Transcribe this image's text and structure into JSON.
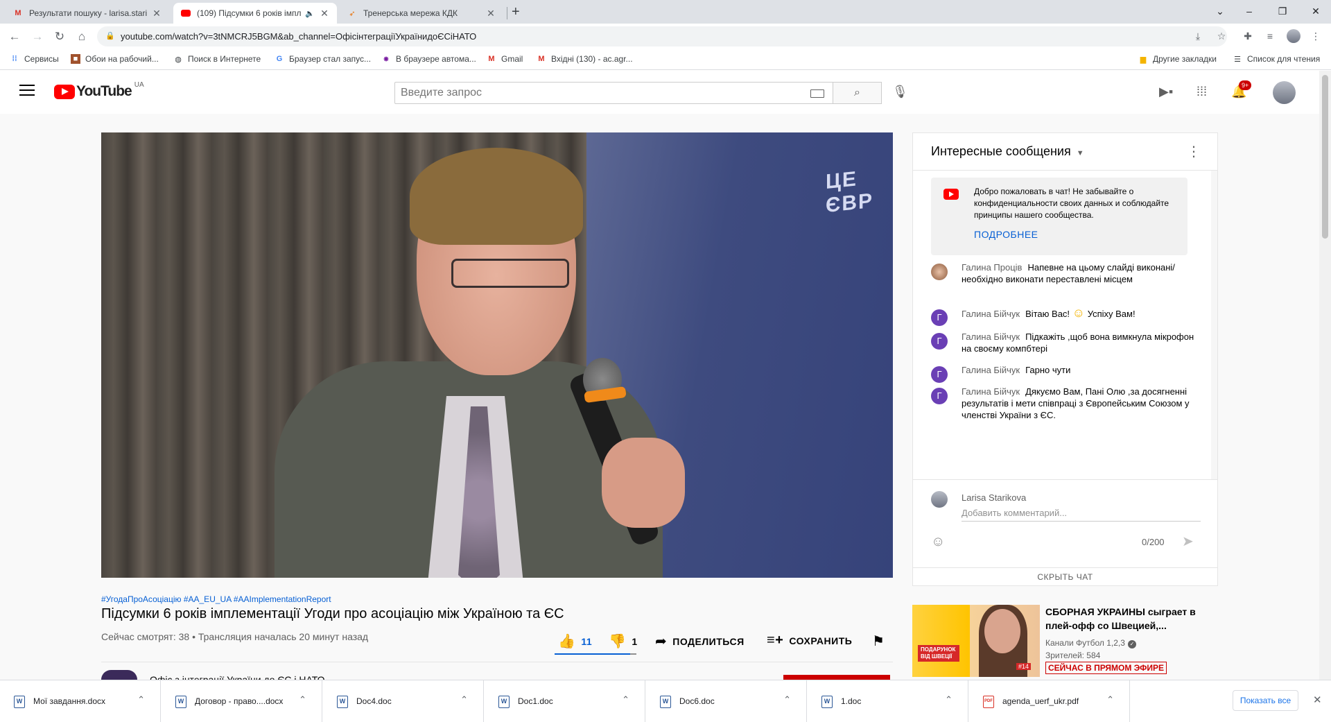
{
  "browser": {
    "tabs": [
      {
        "title": "Результати пошуку - larisa.starik",
        "favicon": "gmail-icon"
      },
      {
        "title": "(109) Підсумки 6 років імпл",
        "favicon": "youtube-icon",
        "active": true,
        "audio": true
      },
      {
        "title": "Тренерська мережа КДК",
        "favicon": "bird-icon"
      }
    ],
    "url": "youtube.com/watch?v=3tNMCRJ5BGM&ab_channel=ОфісінтеграціїУкраїнидоЄСіНАТО",
    "bookmarks": [
      {
        "label": "Сервисы",
        "icon": "apps-icon"
      },
      {
        "label": "Обои на рабочий...",
        "icon": "wallpaper-icon"
      },
      {
        "label": "Поиск в Интернете",
        "icon": "globe-icon"
      },
      {
        "label": "Браузер стал запус...",
        "icon": "google-icon"
      },
      {
        "label": "В браузере автома...",
        "icon": "virus-icon"
      },
      {
        "label": "Gmail",
        "icon": "gmail-icon"
      },
      {
        "label": "Вхідні (130) - ac.agr...",
        "icon": "gmail-icon"
      }
    ],
    "bookmarks_right": [
      {
        "label": "Другие закладки",
        "icon": "folder-icon"
      },
      {
        "label": "Список для чтения",
        "icon": "reading-list-icon"
      }
    ]
  },
  "youtube": {
    "logo_text": "YouTube",
    "country_code": "UA",
    "search_placeholder": "Введите запрос",
    "notifications_badge": "9+"
  },
  "video": {
    "banner_text": "ЦЕ ЄВР",
    "hashtags": "#УгодаПроАсоціацію #AA_EU_UA #AAImplementationReport",
    "title": "Підсумки 6 років імплементації Угоди про асоціацію між Україною та ЄС",
    "meta": "Сейчас смотрят: 38 • Трансляция началась 20 минут назад",
    "likes": "11",
    "dislikes": "1",
    "like_ratio": 0.92,
    "share_label": "ПОДЕЛИТЬСЯ",
    "save_label": "СОХРАНИТЬ",
    "owner_name": "Офіс з інтеграції України до ЄС і НАТО"
  },
  "chat": {
    "header": "Интересные сообщения",
    "welcome_text": "Добро пожаловать в чат! Не забывайте о конфиденциальности своих данных и соблюдайте принципы нашего сообщества.",
    "welcome_more": "ПОДРОБНЕЕ",
    "messages": [
      {
        "author": "Галина Проців",
        "text": "Напевне на цьому слайді виконані/ необхідно виконати переставлені місцем",
        "avatar": "photo"
      },
      {
        "author": "Галина Бійчук",
        "text": "Вітаю Вас!",
        "text2": "Успіху Вам!",
        "emoji": "☺",
        "avatar_letter": "Г"
      },
      {
        "author": "Галина Бійчук",
        "text": "Підкажіть ,щоб вона вимкнула мікрофон на своєму компбтері",
        "avatar_letter": "Г"
      },
      {
        "author": "Галина Бійчук",
        "text": "Гарно чути",
        "avatar_letter": "Г"
      },
      {
        "author": "Галина Бійчук",
        "text": "Дякуємо Вам, Пані Олю ,за досягненні результатів і мети співпраці з Європейським Союзом у членстві України з ЄС.",
        "avatar_letter": "Г"
      }
    ],
    "user_name": "Larisa Starikova",
    "comment_placeholder": "Добавить комментарий...",
    "counter": "0/200",
    "hide_chat": "СКРЫТЬ ЧАТ"
  },
  "recommendation": {
    "title": "СБОРНАЯ УКРАИНЫ сыграет в плей-офф со Швецией,...",
    "channel": "Канали Футбол 1,2,3",
    "viewers": "Зрителей: 584",
    "live": "СЕЙЧАС В ПРЯМОМ ЭФИРЕ",
    "thumb_badge": "ПОДАРУНОК ВІД ШВЕЦІЇ",
    "thumb_tag": "#14"
  },
  "downloads": {
    "files": [
      {
        "name": "Мої завдання.docx",
        "type": "W"
      },
      {
        "name": "Договор - право....docx",
        "type": "W"
      },
      {
        "name": "Doc4.doc",
        "type": "W"
      },
      {
        "name": "Doc1.doc",
        "type": "W"
      },
      {
        "name": "Doc6.doc",
        "type": "W"
      },
      {
        "name": "1.doc",
        "type": "W"
      },
      {
        "name": "agenda_uerf_ukr.pdf",
        "type": "PDF"
      }
    ],
    "show_all": "Показать все"
  }
}
